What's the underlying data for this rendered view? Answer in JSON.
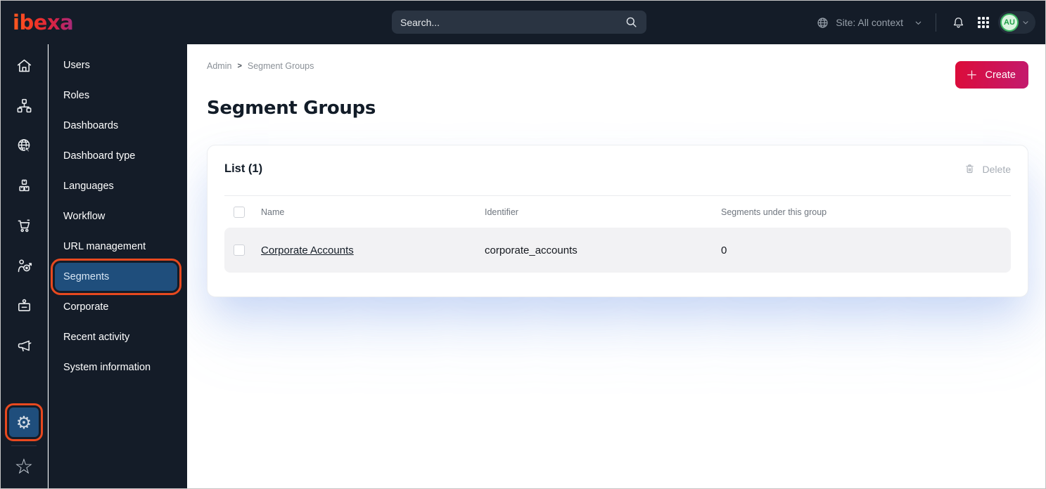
{
  "topbar": {
    "logo_text": "ibexa",
    "search_placeholder": "Search...",
    "site_context_label": "Site: All context",
    "avatar_initials": "AU",
    "icons": [
      "globe-icon",
      "chevron-down-icon",
      "bell-icon",
      "app-grid-icon"
    ]
  },
  "icon_rail": {
    "items": [
      "home-icon",
      "sitemap-icon",
      "globe-cursor-icon",
      "boxes-icon",
      "cart-icon",
      "personalization-target-icon",
      "badge-icon",
      "megaphone-icon"
    ],
    "bottom_items": [
      "gear-icon",
      "star-icon"
    ],
    "active_icon": "gear-icon"
  },
  "sidebar": {
    "items": [
      "Users",
      "Roles",
      "Dashboards",
      "Dashboard type",
      "Languages",
      "Workflow",
      "URL management",
      "Segments",
      "Corporate",
      "Recent activity",
      "System information"
    ],
    "active_item": "Segments"
  },
  "breadcrumb": {
    "section": "Admin",
    "separator": ">",
    "current": "Segment Groups"
  },
  "page": {
    "title": "Segment Groups"
  },
  "toolbar": {
    "create_label": "Create"
  },
  "list_card": {
    "title": "List (1)",
    "delete_label": "Delete",
    "columns": {
      "name": "Name",
      "identifier": "Identifier",
      "segments": "Segments under this group"
    },
    "rows": [
      {
        "name": "Corporate Accounts",
        "identifier": "corporate_accounts",
        "segments_count": "0"
      }
    ]
  },
  "colors": {
    "topbar_bg": "#141c28",
    "active_blue": "#1f4e7c",
    "annotation_orange": "#e8491f",
    "create_gradient_start": "#dc0c39",
    "create_gradient_end": "#c31a6e",
    "avatar_green": "#1f9e48",
    "card_glow": "rgba(100,140,225,0.28)"
  }
}
